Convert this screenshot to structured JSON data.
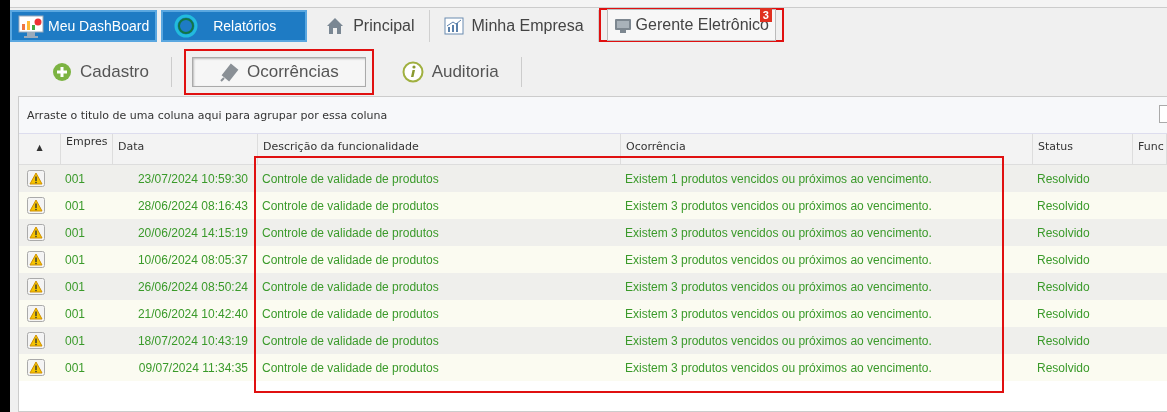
{
  "nav": {
    "shortcuts": [
      {
        "label": "Meu DashBoard",
        "kind": "dashboard"
      },
      {
        "label": "Relatórios",
        "kind": "reports"
      }
    ],
    "tabs": [
      {
        "label": "Principal",
        "selected": false,
        "highlighted": false
      },
      {
        "label": "Minha Empresa",
        "selected": false,
        "highlighted": false
      },
      {
        "label": "Gerente Eletrônico",
        "selected": true,
        "highlighted": true,
        "badge": "3"
      }
    ]
  },
  "subtabs": [
    {
      "label": "Cadastro",
      "selected": false,
      "highlighted": false
    },
    {
      "label": "Ocorrências",
      "selected": true,
      "highlighted": true
    },
    {
      "label": "Auditoria",
      "selected": false,
      "highlighted": false
    }
  ],
  "grid": {
    "group_hint": "Arraste o titulo de uma coluna aqui para agrupar por essa coluna",
    "highlighted": true,
    "columns": [
      "▲",
      "Empres",
      "Data",
      "Descrição da funcionalidade",
      "Ocorrência",
      "Status",
      "Func"
    ],
    "rows": [
      {
        "empresa": "001",
        "data": "23/07/2024 10:59:30",
        "descricao": "Controle de validade de produtos",
        "ocorrencia": "Existem 1 produtos vencidos ou próximos ao vencimento.",
        "status": "Resolvido"
      },
      {
        "empresa": "001",
        "data": "28/06/2024 08:16:43",
        "descricao": "Controle de validade de produtos",
        "ocorrencia": "Existem 3 produtos vencidos ou próximos ao vencimento.",
        "status": "Resolvido"
      },
      {
        "empresa": "001",
        "data": "20/06/2024 14:15:19",
        "descricao": "Controle de validade de produtos",
        "ocorrencia": "Existem 3 produtos vencidos ou próximos ao vencimento.",
        "status": "Resolvido"
      },
      {
        "empresa": "001",
        "data": "10/06/2024 08:05:37",
        "descricao": "Controle de validade de produtos",
        "ocorrencia": "Existem 3 produtos vencidos ou próximos ao vencimento.",
        "status": "Resolvido"
      },
      {
        "empresa": "001",
        "data": "26/06/2024 08:50:24",
        "descricao": "Controle de validade de produtos",
        "ocorrencia": "Existem 3 produtos vencidos ou próximos ao vencimento.",
        "status": "Resolvido"
      },
      {
        "empresa": "001",
        "data": "21/06/2024 10:42:40",
        "descricao": "Controle de validade de produtos",
        "ocorrencia": "Existem 3 produtos vencidos ou próximos ao vencimento.",
        "status": "Resolvido"
      },
      {
        "empresa": "001",
        "data": "18/07/2024 10:43:19",
        "descricao": "Controle de validade de produtos",
        "ocorrencia": "Existem 3 produtos vencidos ou próximos ao vencimento.",
        "status": "Resolvido"
      },
      {
        "empresa": "001",
        "data": "09/07/2024 11:34:35",
        "descricao": "Controle de validade de produtos",
        "ocorrencia": "Existem 3 produtos vencidos ou próximos ao vencimento.",
        "status": "Resolvido"
      }
    ]
  }
}
